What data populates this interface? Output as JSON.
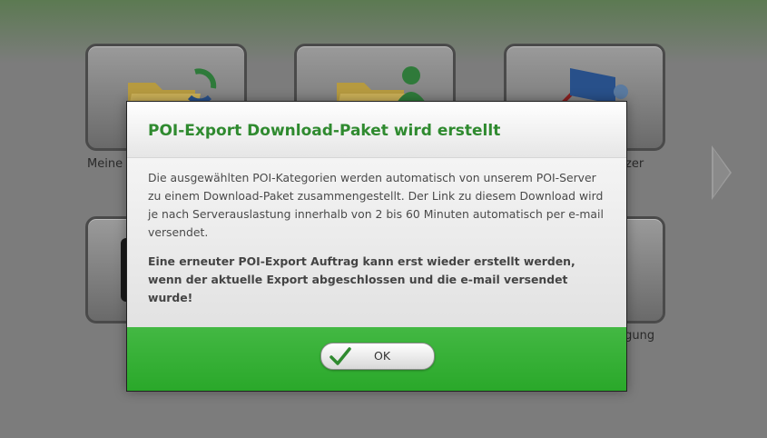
{
  "background": {
    "tiles": [
      {
        "label": "Meine",
        "position": "top-left"
      },
      {
        "label": "",
        "position": "top-middle"
      },
      {
        "label": "zer",
        "position": "top-right"
      },
      {
        "label": "",
        "position": "bottom-left"
      },
      {
        "label": "rgung",
        "position": "bottom-right"
      }
    ]
  },
  "dialog": {
    "title": "POI-Export Download-Paket wird erstellt",
    "message": "Die ausgewählten POI-Kategorien werden automatisch von unserem POI-Server zu einem Download-Paket zusammengestellt. Der Link zu diesem Download wird je nach Serverauslastung innerhalb von 2 bis 60 Minuten automatisch per e-mail versendet.",
    "notice": "Eine erneuter POI-Export Auftrag kann erst wieder erstellt werden, wenn der aktuelle Export abgeschlossen und die e-mail versendet wurde!",
    "ok_label": "OK"
  },
  "colors": {
    "title": "#2f8a2f",
    "footer": "#35b035",
    "check": "#2f8a2f"
  }
}
